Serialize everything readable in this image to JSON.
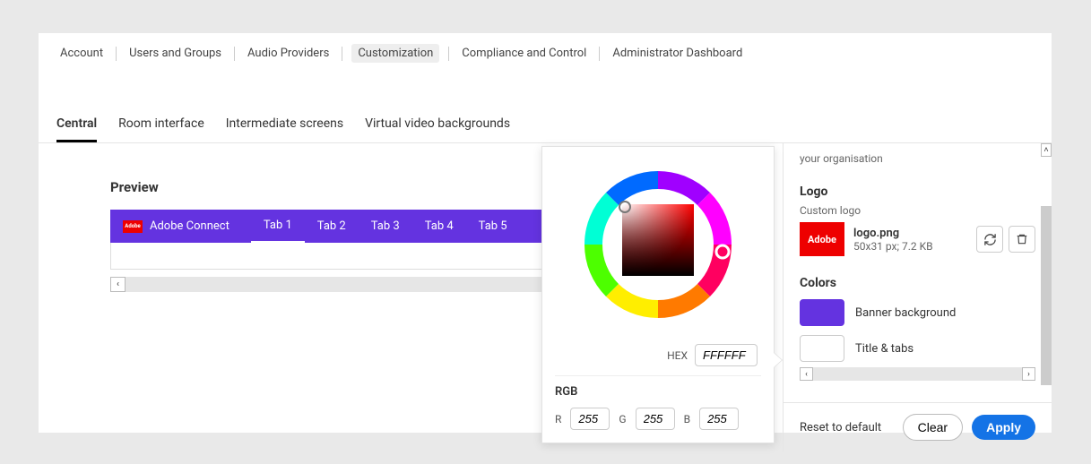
{
  "nav": {
    "items": [
      "Account",
      "Users and Groups",
      "Audio Providers",
      "Customization",
      "Compliance and Control",
      "Administrator Dashboard"
    ],
    "active_index": 3
  },
  "subtabs": {
    "items": [
      "Central",
      "Room interface",
      "Intermediate screens",
      "Virtual video backgrounds"
    ],
    "active_index": 0
  },
  "preview": {
    "title": "Preview",
    "banner_title": "Adobe Connect",
    "tabs": [
      "Tab 1",
      "Tab 2",
      "Tab 3",
      "Tab 4",
      "Tab 5"
    ],
    "active_tab_index": 0
  },
  "side": {
    "hint": "your organisation",
    "logo_heading": "Logo",
    "custom_logo_label": "Custom logo",
    "logo_name": "logo.png",
    "logo_dim": "50x31 px; 7.2 KB",
    "logo_brand": "Adobe",
    "colors_heading": "Colors",
    "banner_bg_label": "Banner background",
    "title_tabs_label": "Title & tabs",
    "reset_label": "Reset to default",
    "clear_label": "Clear",
    "apply_label": "Apply",
    "banner_bg_color": "#6433e0",
    "title_tabs_color": "#ffffff"
  },
  "picker": {
    "hex_label": "HEX",
    "hex_value": "FFFFFF",
    "rgb_label": "RGB",
    "r_label": "R",
    "g_label": "G",
    "b_label": "B",
    "r": "255",
    "g": "255",
    "b": "255"
  }
}
